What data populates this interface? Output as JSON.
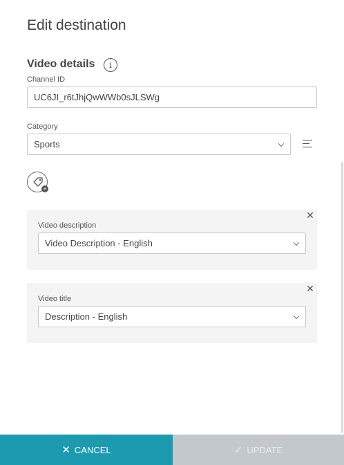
{
  "page": {
    "title": "Edit destination"
  },
  "video_details": {
    "heading": "Video details",
    "info_icon": "i",
    "channel_id": {
      "label": "Channel ID",
      "value": "UC6JI_r6tJhjQwWWb0sJLSWg"
    },
    "category": {
      "label": "Category",
      "value": "Sports"
    }
  },
  "cards": [
    {
      "label": "Video description",
      "value": "Video Description - English"
    },
    {
      "label": "Video title",
      "value": "Description - English"
    }
  ],
  "footer": {
    "cancel_label": "CANCEL",
    "cancel_icon": "✕",
    "update_label": "UPDATE",
    "update_icon": "✓"
  },
  "colors": {
    "primary": "#1c9ab0",
    "disabled": "#c2c8cb",
    "card_bg": "#f4f4f4"
  }
}
